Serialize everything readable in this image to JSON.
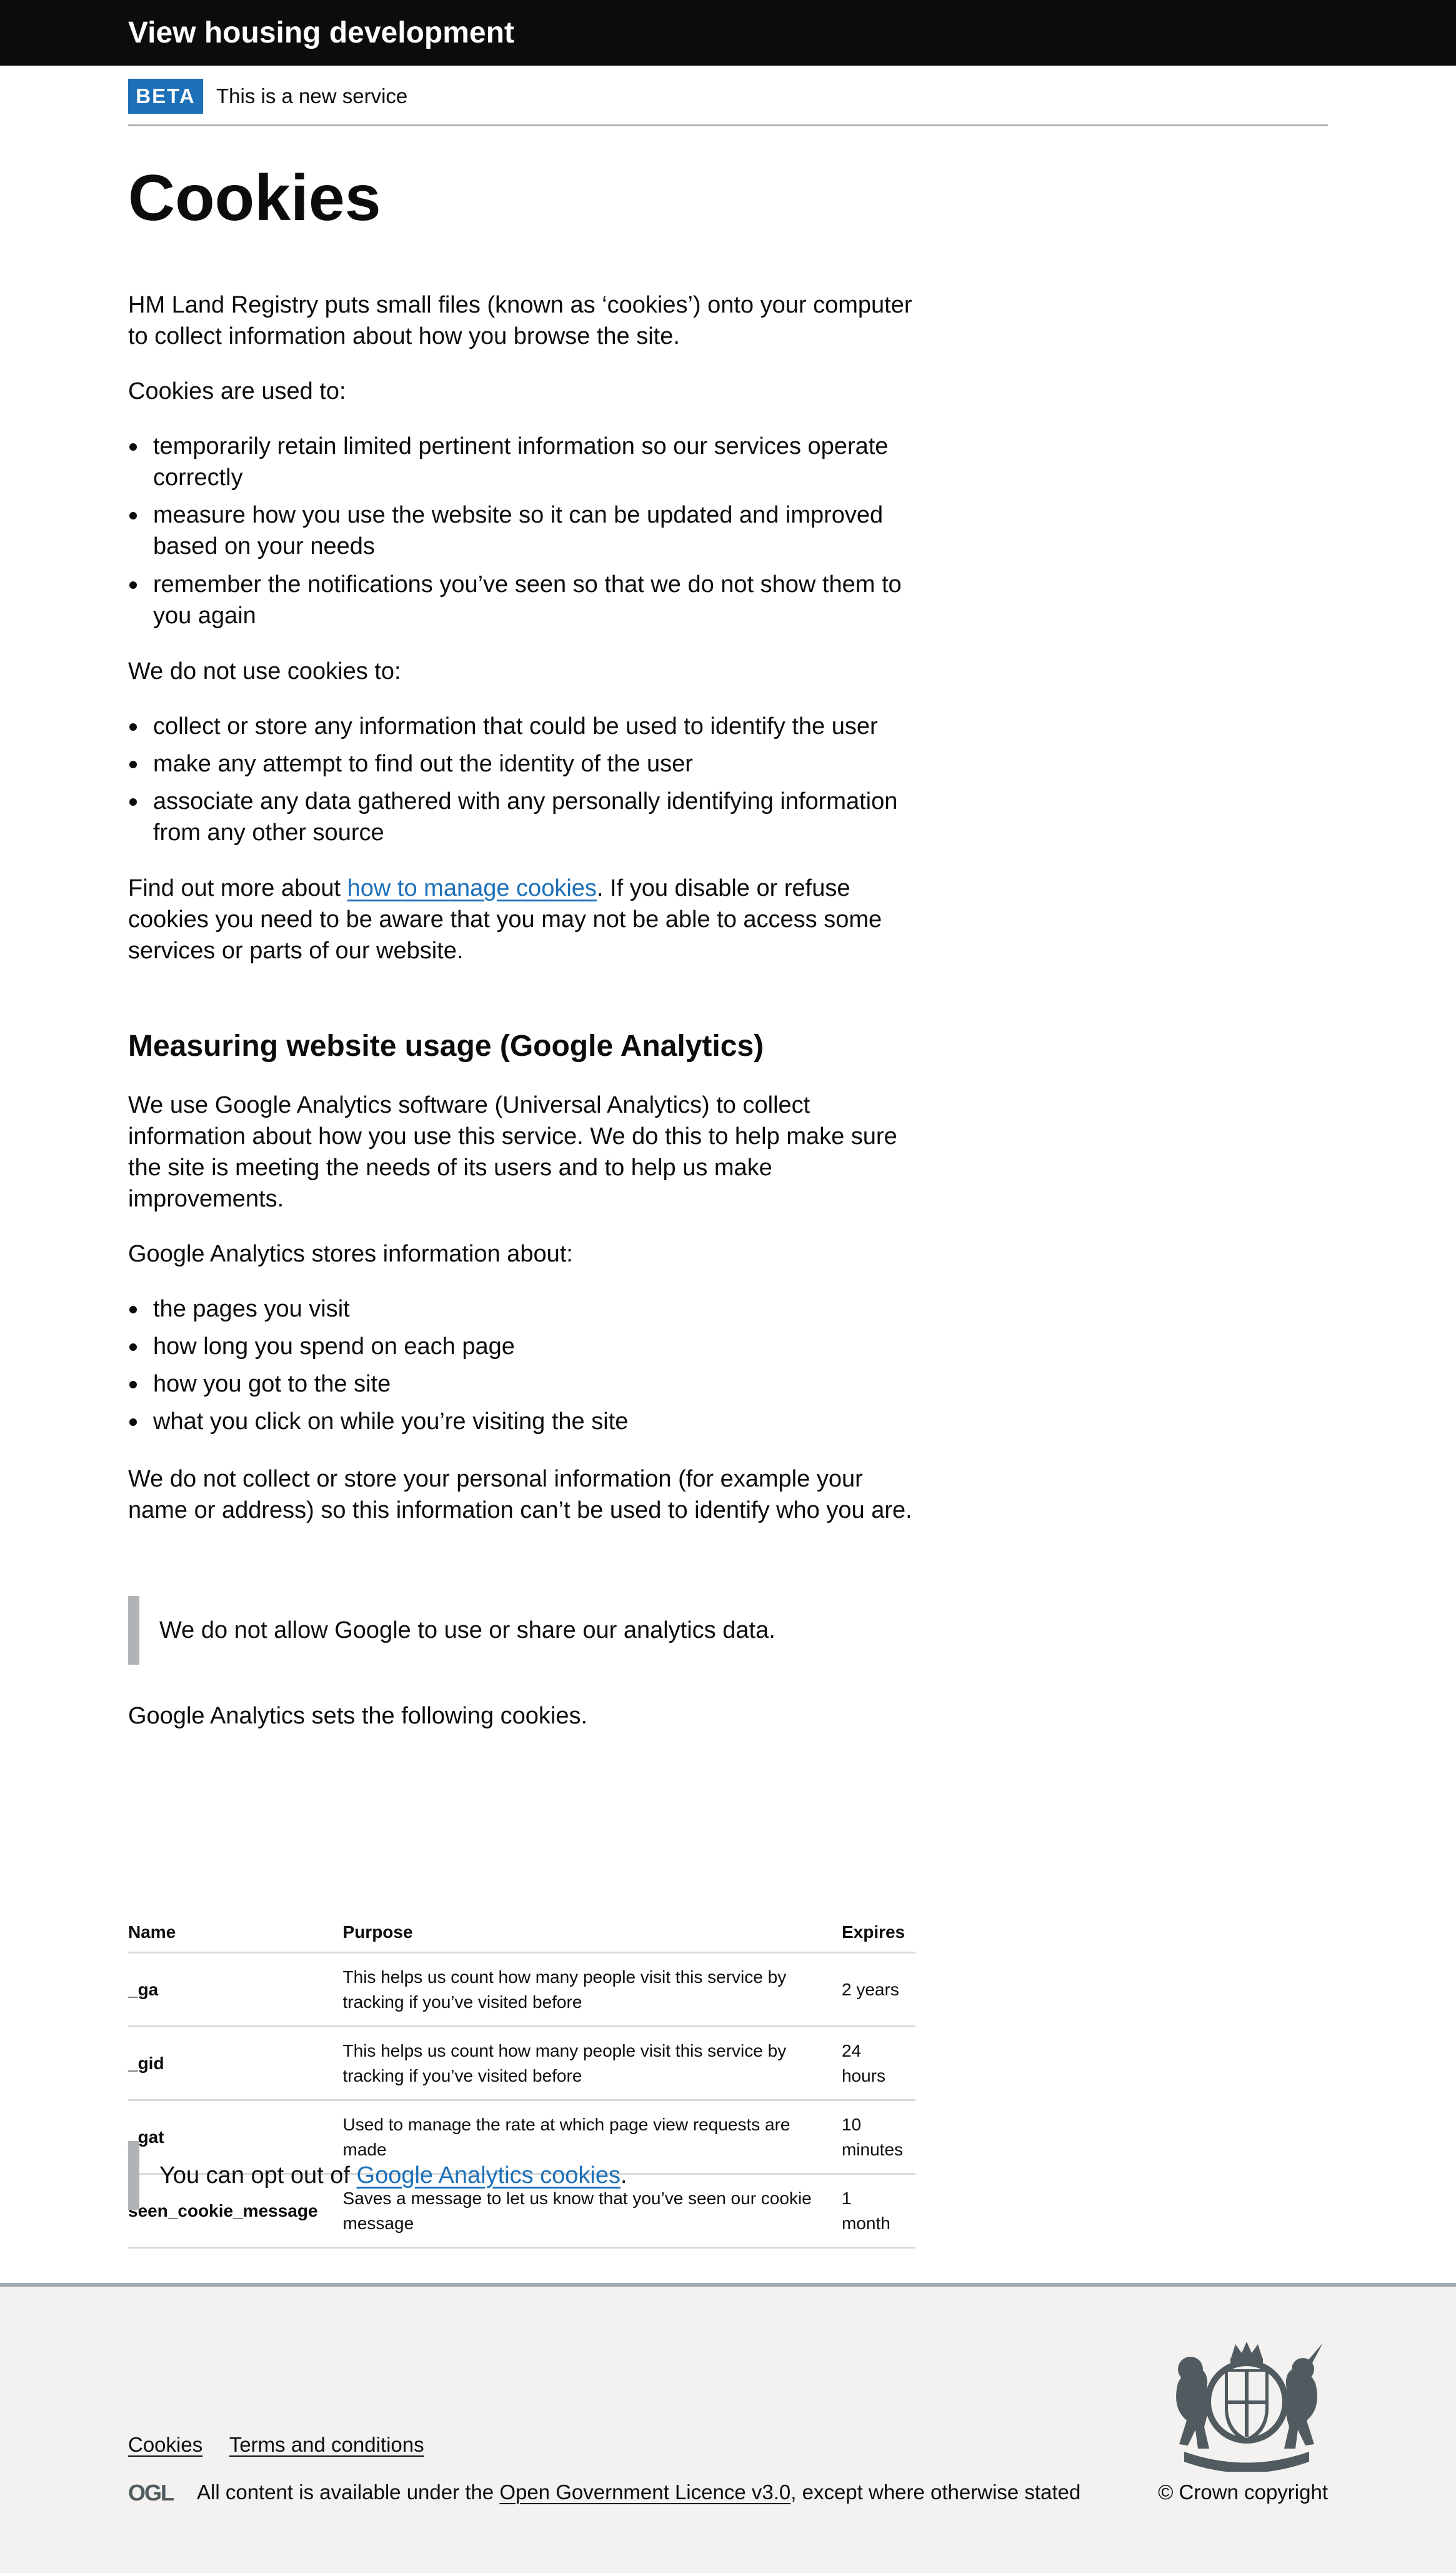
{
  "header": {
    "service_name": "View housing development"
  },
  "phase_banner": {
    "tag": "BETA",
    "text": "This is a new service"
  },
  "main": {
    "title": "Cookies",
    "intro": "HM Land Registry puts small files (known as ‘cookies’) onto your computer to collect information about how you browse the site.",
    "used_to_heading": "Cookies are used to:",
    "used_to": [
      "temporarily retain limited pertinent information so our services operate correctly",
      "measure how you use the website so it can be updated and improved based on your needs",
      "remember the notifications you’ve seen so that we do not show them to you again"
    ],
    "not_used_heading": "We do not use cookies to:",
    "not_used": [
      "collect or store any information that could be used to identify the user",
      "make any attempt to find out the identity of the user",
      "associate any data gathered with any personally identifying information from any other source"
    ],
    "find_out_prefix": "Find out more about ",
    "find_out_link": "how to manage cookies",
    "find_out_suffix": ". If you disable or refuse cookies you need to be aware that you may not be able to access some services or parts of our website.",
    "analytics_heading": "Measuring website usage (Google Analytics)",
    "analytics_intro": "We use Google Analytics software (Universal Analytics) to collect information about how you use this service. We do this to help make sure the site is meeting the needs of its users and to help us make improvements.",
    "stores_heading": "Google Analytics stores information about:",
    "stores": [
      "the pages you visit",
      "how long you spend on each page",
      "how you got to the site",
      "what you click on while you’re visiting the site"
    ],
    "personal_info": "We do not collect or store your personal information (for example your name or address) so this information can’t be used to identify who you are.",
    "inset_share": "We do not allow Google to use or share our analytics data.",
    "sets_cookies": "Google Analytics sets the following cookies.",
    "table": {
      "headers": [
        "Name",
        "Purpose",
        "Expires"
      ],
      "rows": [
        {
          "name": "_ga",
          "purpose": "This helps us count how many people visit this service by tracking if you’ve visited before",
          "expires": "2 years"
        },
        {
          "name": "_gid",
          "purpose": "This helps us count how many people visit this service by tracking if you’ve visited before",
          "expires": "24 hours"
        },
        {
          "name": "_gat",
          "purpose": "Used to manage the rate at which page view requests are made",
          "expires": "10 minutes"
        },
        {
          "name": "seen_cookie_message",
          "purpose": "Saves a message to let us know that you’ve seen our cookie message",
          "expires": "1 month"
        }
      ]
    },
    "opt_out_prefix": "You can opt out of ",
    "opt_out_link": "Google Analytics cookies",
    "opt_out_suffix": "."
  },
  "footer": {
    "links": [
      "Cookies",
      "Terms and conditions"
    ],
    "ogl_logo": "OGL",
    "licence_prefix": "All content is available under the ",
    "licence_link": "Open Government Licence v3.0",
    "licence_suffix": ", except where otherwise stated",
    "copyright": "© Crown copyright",
    "crest_icon": "royal-coat-of-arms-icon"
  }
}
